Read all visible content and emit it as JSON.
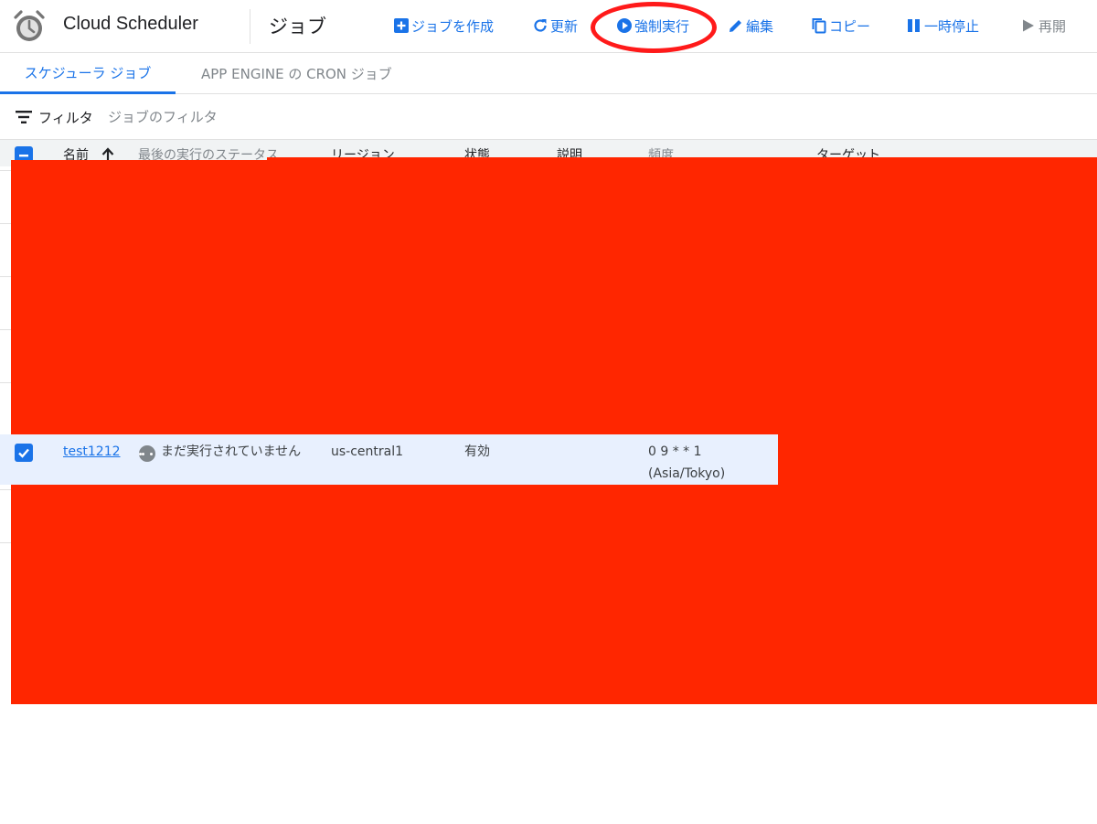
{
  "header": {
    "app_title": "Cloud Scheduler",
    "page_title": "ジョブ"
  },
  "toolbar": {
    "create": "ジョブを作成",
    "refresh": "更新",
    "run_now": "強制実行",
    "edit": "編集",
    "copy": "コピー",
    "pause": "一時停止",
    "resume": "再開"
  },
  "tabs": {
    "scheduler_jobs": "スケジューラ ジョブ",
    "app_engine_cron": "APP ENGINE の CRON ジョブ"
  },
  "filter": {
    "label": "フィルタ",
    "placeholder": "ジョブのフィルタ"
  },
  "table": {
    "columns": {
      "name": "名前",
      "last_run_status": "最後の実行のステータス",
      "region": "リージョン",
      "state": "状態",
      "description": "説明",
      "frequency": "頻度",
      "target": "ターゲット"
    },
    "rows": [
      {
        "name": "test1212",
        "last_run_status": "まだ実行されていません",
        "region": "us-central1",
        "state": "有効",
        "description": "",
        "frequency_line1": "0 9 * * 1",
        "frequency_line2": "(Asia/Tokyo)",
        "selected": true
      }
    ]
  },
  "colors": {
    "accent": "#1a73e8",
    "redaction": "#ff2600",
    "highlight_ring": "#ff1a1a",
    "selected_row": "#e8f0fe"
  },
  "icons": {
    "app_logo": "alarm-clock-icon",
    "create": "add-box-icon",
    "refresh": "refresh-icon",
    "run_now": "play-circle-icon",
    "edit": "pencil-icon",
    "copy": "copy-icon",
    "pause": "pause-icon",
    "resume": "play-icon",
    "filter": "filter-list-icon",
    "sort": "arrow-up-icon",
    "status": "more-horiz-circle-icon"
  }
}
